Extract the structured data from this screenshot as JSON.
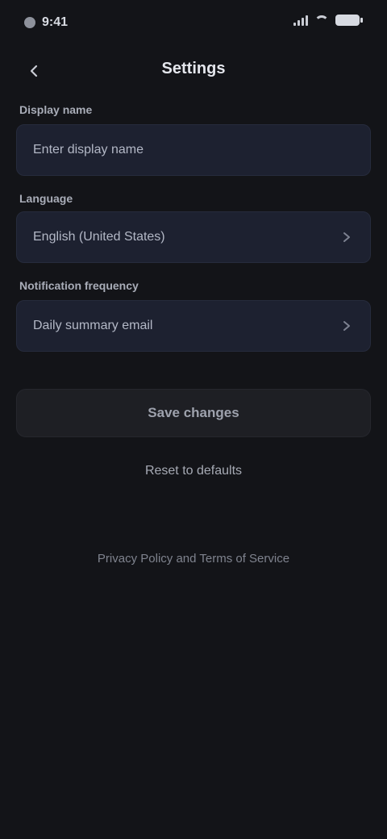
{
  "status_bar": {
    "time": "9:41"
  },
  "header": {
    "title": "Settings"
  },
  "sections": [
    {
      "label": "Display name",
      "value": "Enter display name",
      "has_chevron": false
    },
    {
      "label": "Language",
      "value": "English (United States)",
      "has_chevron": true
    },
    {
      "label": "Notification frequency",
      "value": "Daily summary email",
      "has_chevron": true
    }
  ],
  "actions": {
    "primary_label": "Save changes",
    "secondary_label": "Reset to defaults"
  },
  "footer": {
    "link_label": "Privacy Policy and Terms of Service"
  },
  "icons": {
    "back": "chevron-left-icon",
    "row_chevron": "chevron-right-icon"
  },
  "colors": {
    "background": "#131418",
    "field_background": "#1d2130",
    "button_background": "#1e1f24"
  }
}
